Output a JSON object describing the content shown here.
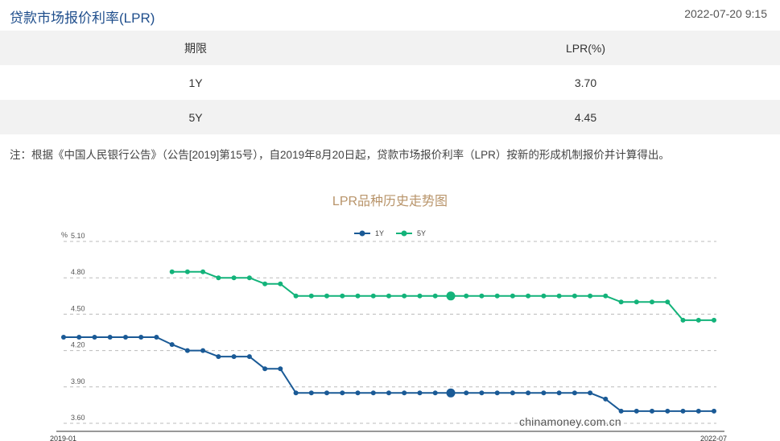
{
  "header": {
    "title": "贷款市场报价利率(LPR)",
    "timestamp": "2022-07-20 9:15"
  },
  "table": {
    "columns": [
      "期限",
      "LPR(%)"
    ],
    "rows": [
      {
        "term": "1Y",
        "rate": "3.70"
      },
      {
        "term": "5Y",
        "rate": "4.45"
      }
    ]
  },
  "note": "注：根据《中国人民银行公告》（公告[2019]第15号），自2019年8月20日起，贷款市场报价利率（LPR）按新的形成机制报价并计算得出。",
  "watermark": "chinamoney.com.cn",
  "colors": {
    "series_1y": "#1a5a96",
    "series_5y": "#13b37a",
    "title_color": "#b8946a",
    "grid": "#bbbbbb"
  },
  "chart_data": {
    "type": "line",
    "title": "LPR品种历史走势图",
    "ylabel": "%",
    "ylim": [
      3.6,
      5.1
    ],
    "yticks": [
      "5.10",
      "4.80",
      "4.50",
      "4.20",
      "3.90",
      "3.60"
    ],
    "xtick_labels": [
      "2019-01",
      "2022-07"
    ],
    "x": [
      "2019-01",
      "2019-02",
      "2019-03",
      "2019-04",
      "2019-05",
      "2019-06",
      "2019-07",
      "2019-08",
      "2019-09",
      "2019-10",
      "2019-11",
      "2019-12",
      "2020-01",
      "2020-02",
      "2020-03",
      "2020-04",
      "2020-05",
      "2020-06",
      "2020-07",
      "2020-08",
      "2020-09",
      "2020-10",
      "2020-11",
      "2020-12",
      "2021-01",
      "2021-02",
      "2021-03",
      "2021-04",
      "2021-05",
      "2021-06",
      "2021-07",
      "2021-08",
      "2021-09",
      "2021-10",
      "2021-11",
      "2021-12",
      "2022-01",
      "2022-02",
      "2022-03",
      "2022-04",
      "2022-05",
      "2022-06",
      "2022-07"
    ],
    "legend_position": "top",
    "grid": true,
    "series": [
      {
        "name": "1Y",
        "values": [
          4.31,
          4.31,
          4.31,
          4.31,
          4.31,
          4.31,
          4.31,
          4.25,
          4.2,
          4.2,
          4.15,
          4.15,
          4.15,
          4.05,
          4.05,
          3.85,
          3.85,
          3.85,
          3.85,
          3.85,
          3.85,
          3.85,
          3.85,
          3.85,
          3.85,
          3.85,
          3.85,
          3.85,
          3.85,
          3.85,
          3.85,
          3.85,
          3.85,
          3.85,
          3.85,
          3.8,
          3.7,
          3.7,
          3.7,
          3.7,
          3.7,
          3.7,
          3.7
        ]
      },
      {
        "name": "5Y",
        "values": [
          null,
          null,
          null,
          null,
          null,
          null,
          null,
          4.85,
          4.85,
          4.85,
          4.8,
          4.8,
          4.8,
          4.75,
          4.75,
          4.65,
          4.65,
          4.65,
          4.65,
          4.65,
          4.65,
          4.65,
          4.65,
          4.65,
          4.65,
          4.65,
          4.65,
          4.65,
          4.65,
          4.65,
          4.65,
          4.65,
          4.65,
          4.65,
          4.65,
          4.65,
          4.6,
          4.6,
          4.6,
          4.6,
          4.45,
          4.45,
          4.45
        ]
      }
    ]
  }
}
